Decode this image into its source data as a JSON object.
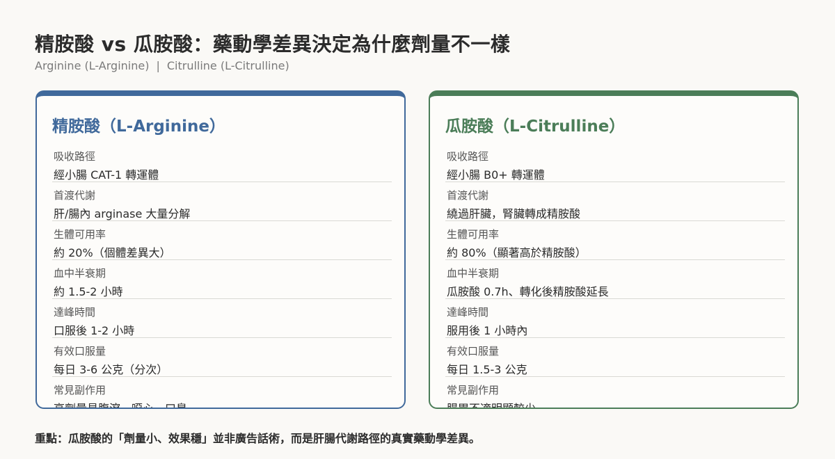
{
  "header": {
    "title": "精胺酸 vs 瓜胺酸：藥動學差異決定為什麼劑量不一樣",
    "subtitle_left": "Arginine (L-Arginine)",
    "subtitle_sep": "|",
    "subtitle_right": "Citrulline (L-Citrulline)"
  },
  "cards": {
    "left": {
      "title": "精胺酸（L-Arginine）",
      "accent": "#40699b",
      "rows": [
        {
          "label": "吸收路徑",
          "value": "經小腸 CAT-1 轉運體"
        },
        {
          "label": "首渡代謝",
          "value": "肝/腸內 arginase 大量分解"
        },
        {
          "label": "生體可用率",
          "value": "約 20%（個體差異大）"
        },
        {
          "label": "血中半衰期",
          "value": "約 1.5-2 小時"
        },
        {
          "label": "達峰時間",
          "value": "口服後 1-2 小時"
        },
        {
          "label": "有效口服量",
          "value": "每日 3-6 公克（分次）"
        },
        {
          "label": "常見副作用",
          "value": "高劑量易腹瀉、噁心、口臭"
        }
      ]
    },
    "right": {
      "title": "瓜胺酸（L-Citrulline）",
      "accent": "#4b7d58",
      "rows": [
        {
          "label": "吸收路徑",
          "value": "經小腸 B0+ 轉運體"
        },
        {
          "label": "首渡代謝",
          "value": "繞過肝臟，腎臟轉成精胺酸"
        },
        {
          "label": "生體可用率",
          "value": "約 80%（顯著高於精胺酸）"
        },
        {
          "label": "血中半衰期",
          "value": "瓜胺酸 0.7h、轉化後精胺酸延長"
        },
        {
          "label": "達峰時間",
          "value": "服用後 1 小時內"
        },
        {
          "label": "有效口服量",
          "value": "每日 1.5-3 公克"
        },
        {
          "label": "常見副作用",
          "value": "腸胃不適明顯較少"
        }
      ]
    }
  },
  "footer": {
    "text": "重點：瓜胺酸的「劑量小、效果穩」並非廣告話術，而是肝腸代謝路徑的真實藥動學差異。"
  }
}
